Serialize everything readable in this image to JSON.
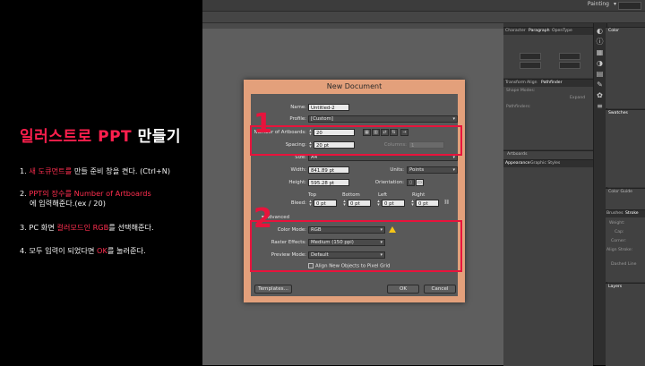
{
  "tutorial": {
    "title_red": "일러스트로 PPT",
    "title_white": "만들기",
    "step1_a": "1. ",
    "step1_hl": "새 도큐먼트를",
    "step1_b": " 만들 준비 창을 켠다. (Ctrl+N)",
    "step2_a": "2. ",
    "step2_hl": "PPT의 장수를 Number of Artboards",
    "step2_b": "에 입력해준다.(ex / 20)",
    "step3_a": "3. PC 화면 ",
    "step3_hl": "컬러모드인 RGB",
    "step3_b": "를 선택해준다.",
    "step4_a": "4. 모두 입력이 되었다면 ",
    "step4_hl": "OK",
    "step4_b": "를 눌러준다."
  },
  "app": {
    "workspace": "Painting",
    "panels": {
      "top_tabs": [
        "Character",
        "Paragraph",
        "OpenType"
      ],
      "color_tab": "Color",
      "transform_tabs": [
        "Transform",
        "Align",
        "Pathfinder"
      ],
      "shape_modes": "Shape Modes:",
      "expand": "Expand",
      "pathfinders": "Pathfinders:",
      "swatches": "Swatches",
      "artboards": "Artboards",
      "appearance_tabs": [
        "Appearance",
        "Graphic Styles"
      ],
      "color_guide": "Color Guide",
      "stroke_tabs": [
        "Brushes",
        "Stroke"
      ],
      "stroke_labels": [
        "Weight:",
        "Cap:",
        "Corner:",
        "Align Stroke:",
        "Dashed Line"
      ],
      "layers": "Layers",
      "layers_right": "Layers"
    }
  },
  "dialog": {
    "title": "New Document",
    "name_label": "Name:",
    "name_value": "Untitled-2",
    "profile_label": "Profile:",
    "profile_value": "[Custom]",
    "artboards_label": "Number of Artboards:",
    "artboards_value": "20",
    "spacing_label": "Spacing:",
    "spacing_value": "20 pt",
    "columns_label": "Columns:",
    "columns_value": "1",
    "size_label": "Size:",
    "size_value": "A4",
    "width_label": "Width:",
    "width_value": "841.89 pt",
    "units_label": "Units:",
    "units_value": "Points",
    "height_label": "Height:",
    "height_value": "595.28 pt",
    "orientation_label": "Orientation:",
    "bleed_headers": [
      "Top",
      "Bottom",
      "Left",
      "Right"
    ],
    "bleed_label": "Bleed:",
    "bleed_values": [
      "0 pt",
      "0 pt",
      "0 pt",
      "0 pt"
    ],
    "advanced_label": "Advanced",
    "color_mode_label": "Color Mode:",
    "color_mode_value": "RGB",
    "raster_label": "Raster Effects:",
    "raster_value": "Medium (150 ppi)",
    "preview_label": "Preview Mode:",
    "preview_value": "Default",
    "align_pixel_label": "Align New Objects to Pixel Grid",
    "templates_button": "Templates...",
    "ok_button": "OK",
    "cancel_button": "Cancel"
  },
  "annotations": {
    "num1": "1",
    "num2": "2",
    "color": "#e8133c"
  }
}
